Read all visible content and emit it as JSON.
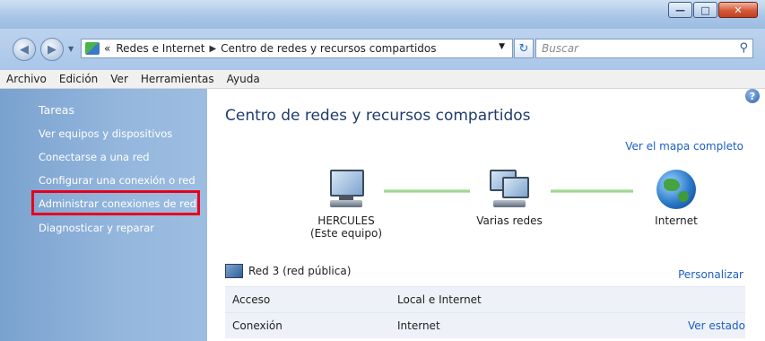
{
  "address": {
    "overflow": "«",
    "crumbs": [
      "Redes e Internet",
      "Centro de redes y recursos compartidos"
    ],
    "search_placeholder": "Buscar"
  },
  "menu": [
    "Archivo",
    "Edición",
    "Ver",
    "Herramientas",
    "Ayuda"
  ],
  "sidebar": {
    "title": "Tareas",
    "links": [
      "Ver equipos y dispositivos",
      "Conectarse a una red",
      "Configurar una conexión o red",
      "Administrar conexiones de red",
      "Diagnosticar y reparar"
    ],
    "highlight_color": "#e8001c"
  },
  "main": {
    "title": "Centro de redes y recursos compartidos",
    "map_link": "Ver el mapa completo",
    "nodes": {
      "computer": {
        "name": "HERCULES",
        "sub": "(Este equipo)"
      },
      "network": {
        "name": "Varias redes"
      },
      "internet": {
        "name": "Internet"
      }
    },
    "network": {
      "name": "Red 3 (red pública)",
      "customize": "Personalizar",
      "rows": [
        {
          "label": "Acceso",
          "value": "Local e Internet"
        },
        {
          "label": "Conexión",
          "value": "Internet",
          "action": "Ver estado"
        }
      ]
    }
  },
  "icons": [
    "back-icon",
    "forward-icon",
    "network-folder-icon",
    "refresh-icon",
    "search-icon",
    "help-icon",
    "computer-icon",
    "multiple-networks-icon",
    "internet-globe-icon",
    "network-icon"
  ]
}
